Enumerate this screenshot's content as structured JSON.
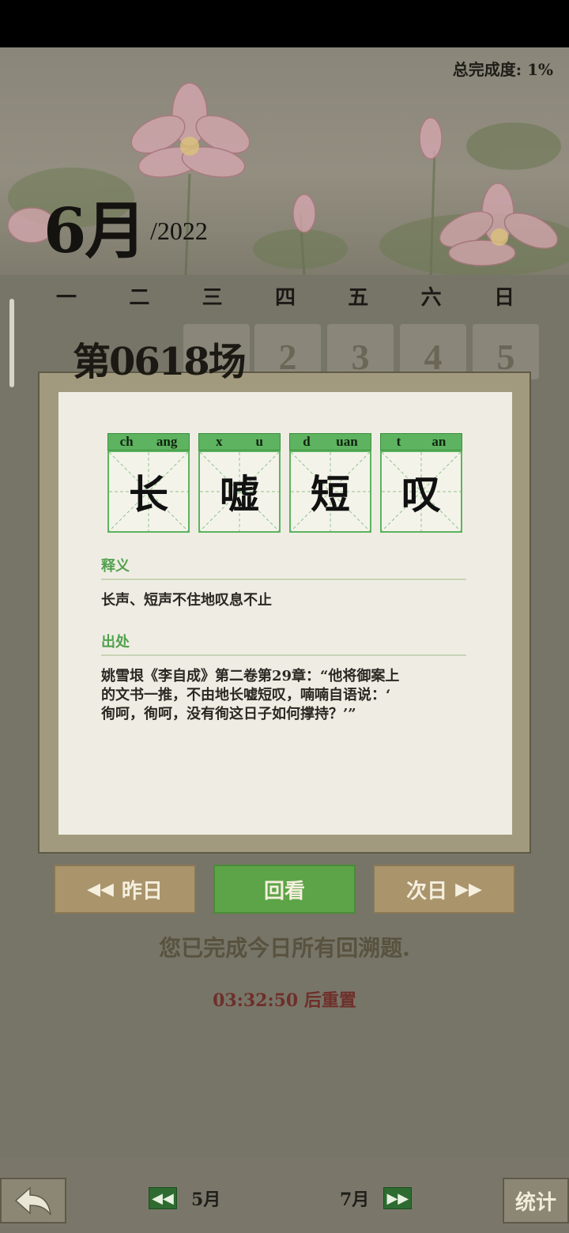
{
  "header": {
    "total_progress": "总完成度: 1%",
    "month": "6月",
    "year": "/2022"
  },
  "weekdays": [
    "一",
    "二",
    "三",
    "四",
    "五",
    "六",
    "日"
  ],
  "visible_days": [
    "2",
    "3",
    "4",
    "5"
  ],
  "level_title": "第0618场",
  "idiom": {
    "chars": [
      {
        "pinyin_initial": "ch",
        "pinyin_final": "ang",
        "hanzi": "长"
      },
      {
        "pinyin_initial": "x",
        "pinyin_final": "u",
        "hanzi": "嘘"
      },
      {
        "pinyin_initial": "d",
        "pinyin_final": "uan",
        "hanzi": "短"
      },
      {
        "pinyin_initial": "t",
        "pinyin_final": "an",
        "hanzi": "叹"
      }
    ],
    "meaning_label": "释义",
    "meaning": "长声、短声不住地叹息不止",
    "source_label": "出处",
    "source_lines": [
      "姚雪垠《李自成》第二卷第29章：“他将御案上",
      "的文书一推，不由地长嘘短叹，喃喃自语说：‘",
      "徇呵，徇呵，没有徇这日子如何撑持？’”"
    ]
  },
  "buttons": {
    "prev_day": "昨日",
    "review": "回看",
    "next_day": "次日"
  },
  "status": {
    "done_message": "您已完成今日所有回溯题.",
    "reset_message": "03:32:50 后重置"
  },
  "bottom_nav": {
    "prev_month": "5月",
    "next_month": "7月",
    "stats": "统计"
  },
  "colors": {
    "accent_green": "#5ca447",
    "pinyin_green": "#5db35f",
    "button_tan": "#a9946c",
    "reset_red": "#6e2f2a"
  },
  "icons": {
    "back": "back-arrow-icon",
    "prev": "double-left-arrow-icon",
    "next": "double-right-arrow-icon"
  }
}
